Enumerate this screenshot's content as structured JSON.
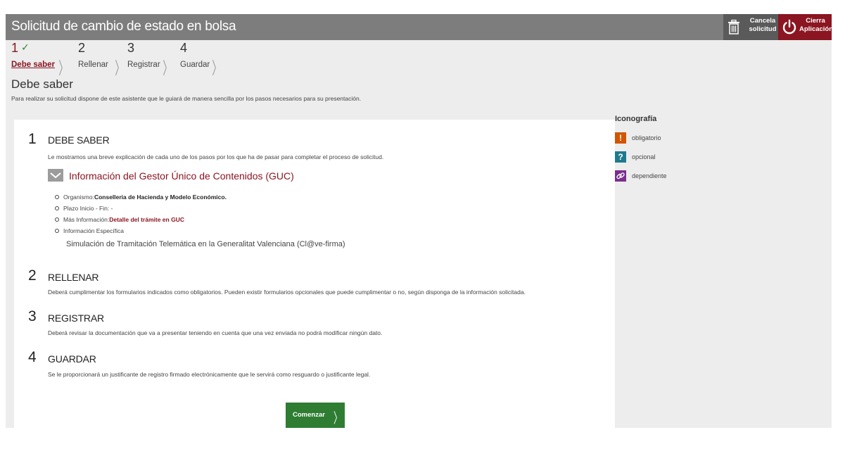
{
  "header": {
    "title": "Solicitud de cambio de estado en bolsa",
    "cancel_label_1": "Cancela",
    "cancel_label_2": "solicitud",
    "close_label_1": "Cierra",
    "close_label_2": "Aplicación"
  },
  "steps": [
    {
      "num": "1",
      "label": "Debe saber",
      "done": true
    },
    {
      "num": "2",
      "label": "Rellenar"
    },
    {
      "num": "3",
      "label": "Registrar"
    },
    {
      "num": "4",
      "label": "Guardar"
    }
  ],
  "page": {
    "title": "Debe saber",
    "description": "Para realizar su solicitud dispone de este asistente que le guiará de manera sencilla por los pasos necesarios para su presentación."
  },
  "sections": [
    {
      "num": "1",
      "heading": "DEBE SABER",
      "text": "Le mostramos una breve explicación de cada uno de los pasos por los que ha de pasar para completar el proceso de solicitud."
    },
    {
      "num": "2",
      "heading": "RELLENAR",
      "text": "Deberá cumplimentar los formularios indicados como obligatorios. Pueden existir formularios opcionales que puede cumplimentar o no, según disponga de la información solicitada."
    },
    {
      "num": "3",
      "heading": "REGISTRAR",
      "text": "Deberá revisar la documentación que va a presentar teniendo en cuenta que una vez enviada no podrá modificar ningún dato."
    },
    {
      "num": "4",
      "heading": "GUARDAR",
      "text": "Se le proporcionará un justificante de registro firmado electrónicamente que le servirá como resguardo o justificante legal."
    }
  ],
  "guc": {
    "title": "Información del Gestor Único de Contenidos (GUC)",
    "organismo_label": "Organismo:",
    "organismo_value": "Conselleria de Hacienda y Modelo Económico.",
    "plazo": "Plazo Inicio - Fin: -",
    "mas_info_label": "Más Información:",
    "mas_info_link": "Detalle del trámite en GUC",
    "info_especifica": "Información Específica",
    "simulacion": "Simulación de Tramitación Telemática en la Generalitat Valenciana (Cl@ve-firma)"
  },
  "actions": {
    "start_label": "Comenzar"
  },
  "legend": {
    "title": "Iconografía",
    "items": [
      {
        "symbol": "!",
        "label": "obligatorio",
        "color": "#d35400",
        "icon": "exclamation-icon"
      },
      {
        "symbol": "?",
        "label": "opcional",
        "color": "#1f7a8c",
        "icon": "question-icon"
      },
      {
        "symbol": "",
        "label": "dependiente",
        "color": "#7b2e8e",
        "icon": "link-icon"
      }
    ]
  },
  "colors": {
    "brand": "#8b1521",
    "header_bg": "#7d7d7d",
    "start_button": "#2e7d32"
  }
}
